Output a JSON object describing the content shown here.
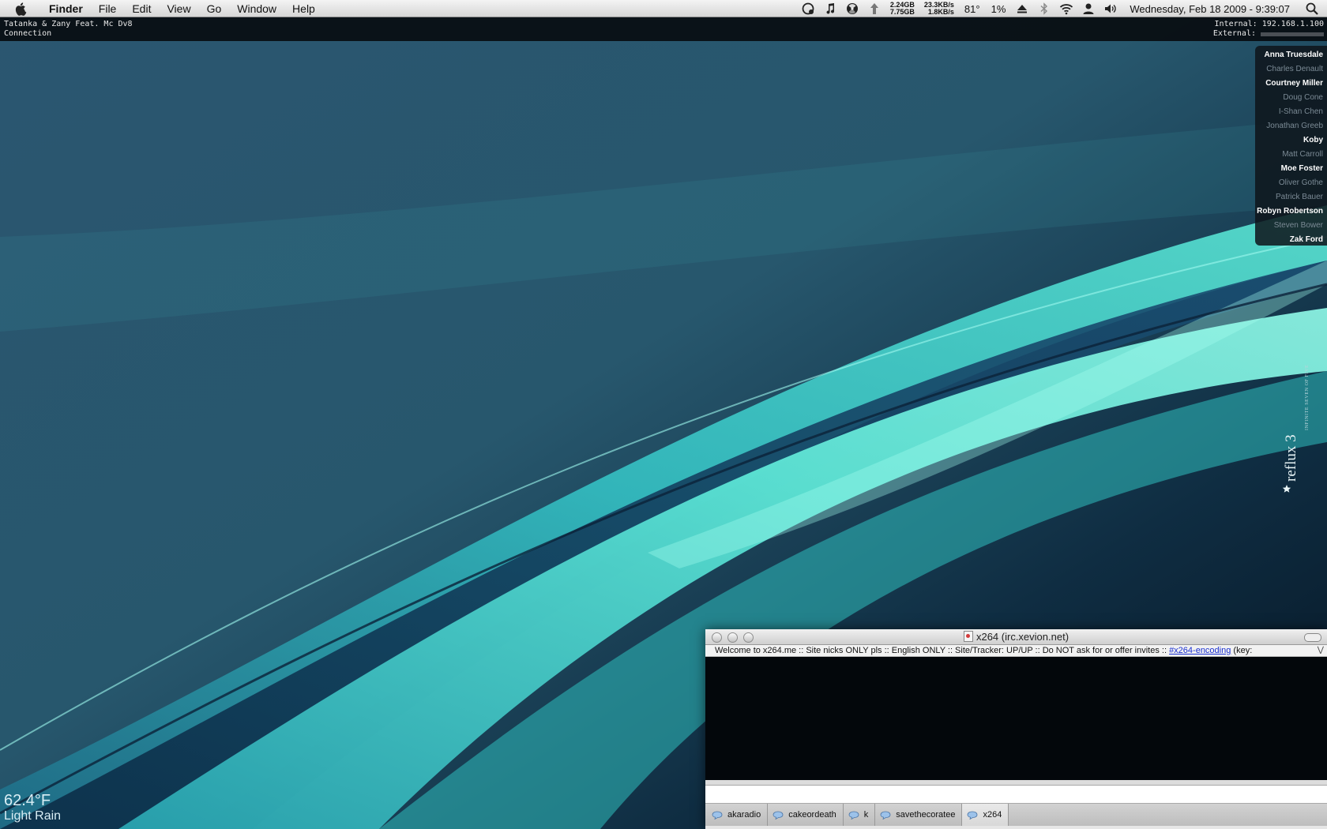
{
  "menubar": {
    "app_name": "Finder",
    "menus": [
      "File",
      "Edit",
      "View",
      "Go",
      "Window",
      "Help"
    ],
    "memory": [
      "2.24GB",
      "7.75GB"
    ],
    "network": [
      "23.3KB/s",
      "1.8KB/s"
    ],
    "temperature": "81°",
    "cpu": "1%",
    "clock": "Wednesday, Feb 18 2009 - 9:39:07"
  },
  "geektool": {
    "now_playing": "Tatanka & Zany Feat. Mc Dv8",
    "connection_label": "Connection",
    "internal": "Internal: 192.168.1.100",
    "external_label": "External:"
  },
  "buddies": [
    {
      "name": "Anna Truesdale",
      "status": "active"
    },
    {
      "name": "Charles Denault",
      "status": "idle"
    },
    {
      "name": "Courtney Miller",
      "status": "active"
    },
    {
      "name": "Doug Cone",
      "status": "idle"
    },
    {
      "name": "I-Shan Chen",
      "status": "idle"
    },
    {
      "name": "Jonathan Greeb",
      "status": "idle"
    },
    {
      "name": "Koby",
      "status": "active"
    },
    {
      "name": "Matt Carroll",
      "status": "idle"
    },
    {
      "name": "Moe Foster",
      "status": "active"
    },
    {
      "name": "Oliver Gothe",
      "status": "idle"
    },
    {
      "name": "Patrick Bauer",
      "status": "idle"
    },
    {
      "name": "Robyn Robertson",
      "status": "active"
    },
    {
      "name": "Steven Bower",
      "status": "idle"
    },
    {
      "name": "Zak Ford",
      "status": "active"
    }
  ],
  "wallpaper": {
    "brand": "reflux 3",
    "tagline": "INFINITE SEVEN OF FIVE"
  },
  "weather": {
    "temp": "62.4°F",
    "condition": "Light Rain"
  },
  "irc": {
    "title": "x264 (irc.xevion.net)",
    "topic_text": "Welcome to x264.me :: Site nicks ONLY pls :: English ONLY :: Site/Tracker: UP/UP :: Do NOT ask for or offer invites :: ",
    "topic_link": "#x264-encoding",
    "topic_tail": " (key:",
    "input_value": "",
    "tabs": [
      "akaradio",
      "cakeordeath",
      "k",
      "savethecoratee",
      "x264"
    ],
    "selected_tab": "x264"
  },
  "colors": {
    "wallpaper_base": "#1f4a63",
    "wallpaper_accent": "#4fe8d6",
    "link": "#1a2fd1"
  }
}
